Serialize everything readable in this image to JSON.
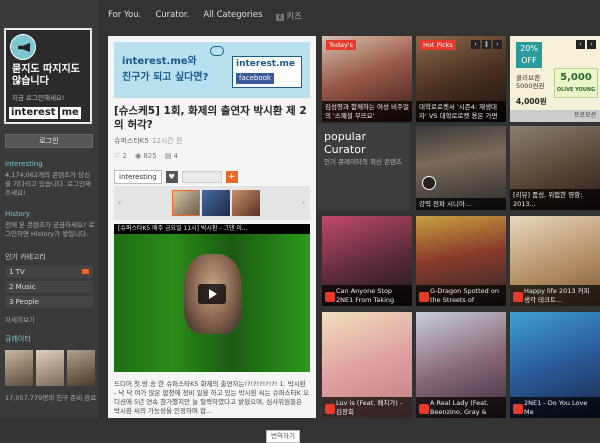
{
  "nav": {
    "for_you": "For You.",
    "curator": "Curator.",
    "all_categories": "All Categories",
    "kids_badge": "K",
    "kids": "키즈"
  },
  "sidebar": {
    "slogan": "묻지도 따지지도 않습니다",
    "login_hint": "지금 로그인해세요!",
    "wordmark_a": "interest",
    "wordmark_b": "me",
    "login_button": "로그인",
    "interesting_head": "interesting",
    "interesting_text": "4,174,062개의 콘텐츠가 당신을 기다리고 있습니다. 로그인해주세요!",
    "history_head": "History",
    "history_text": "전에 본 콘텐츠가 궁금하세요? 로그인하면 History가 쌓입니다.",
    "popular_cat_head": "인기 카테고리",
    "categories": [
      "1 TV",
      "2 Music",
      "3 People"
    ],
    "more": "자세히보기",
    "curator_head": "큐레이터",
    "footer": "17,057,779명의 친구 준비 완료"
  },
  "main": {
    "banner_line1": "interest.me와",
    "banner_line2": "친구가 되고 싶다면?",
    "banner_box_title": "interest.me",
    "banner_box_fb": "facebook",
    "title": "[슈스케5] 1회, 화제의 출연자 박시환 제 2의 허각?",
    "author": "슈퍼스타K5",
    "time": "12시간 전",
    "stats_like": "2",
    "stats_view": "825",
    "stats_share": "4",
    "tag": "interesting",
    "tag_heart": "♥",
    "plus": "+",
    "video_title": "[슈퍼스타K5 매주 금요일 11시] 박시환 - 그댄 이...",
    "description": "드디어 첫.방.송 한 슈퍼스타K5 화제의 출연자는!?!?!?!?!?! 1. 박시환 - 낙 닥 여가 많은 합청에 정비 일을 하고 있는 박시환 씨는 슈퍼스타K 오디션에 5년 연속 참가했지만 늘 탈락하였다고 밝혔으며, 심사위원들은 박시환 씨의 가능성을 인정하며 합...",
    "more_link": "상세보기",
    "translate": "번역하기"
  },
  "tiles": {
    "todays": "Today's",
    "todays_caption": "김성령과 함께하는 여성 비주얼의 '스폐셜 무뜨요'",
    "hotpicks": "Hot Picks",
    "hotpicks_caption": "대학로로켓서 '시즌4: 재생대자' VS 대학로로켓 용은 가면",
    "ad_percent": "20%",
    "ad_off": "OFF",
    "ad_coupon": "콜리브랜 5000원권",
    "ad_price": "4,000원",
    "ad_coupon_amount": "5,000",
    "ad_brand": "OLIVE YOUNG",
    "ad_store": "프로모션",
    "popular_title": "popular Curator",
    "popular_sub": "인기 큐레이터의 최신 콘텐츠",
    "c1": "강력 전파 시니아...",
    "c2": "[리뷰] 품성, 위험한 영항: 2013...",
    "c3": "Can Anyone Stop 2NE1 From Taking",
    "c4": "G-Dragon Spotted on the Streets of",
    "c5": "Happy life 2013 커피 생각 테크트...",
    "c6": "Luv is (Feat. 배치가) - 김장회",
    "c7": "A Real Lady (Feat. Beenzino, Gray &",
    "c8": "2NE1 - Do You Love Me"
  }
}
